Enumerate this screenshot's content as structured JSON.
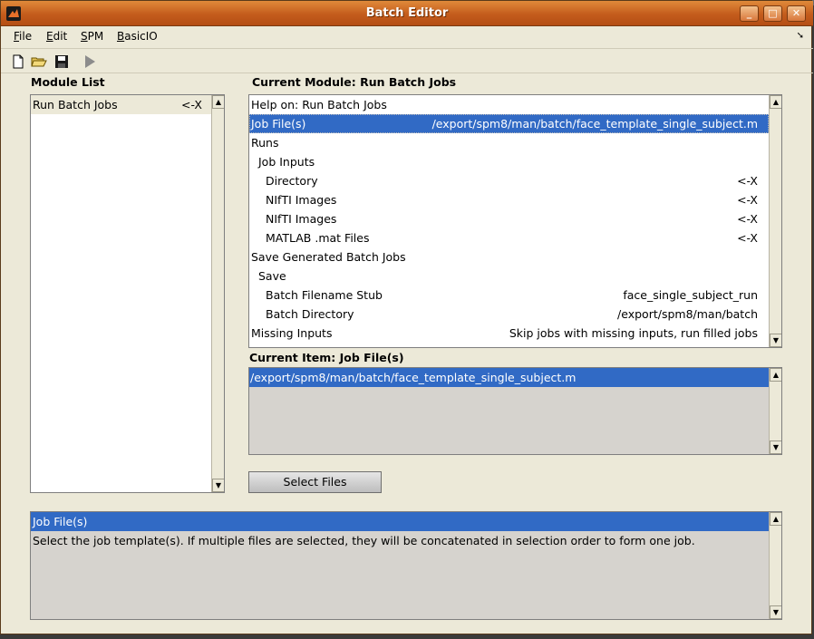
{
  "window": {
    "title": "Batch Editor"
  },
  "menu": [
    {
      "label": "File",
      "mnemonic": "F",
      "rest": "ile"
    },
    {
      "label": "Edit",
      "mnemonic": "E",
      "rest": "dit"
    },
    {
      "label": "SPM",
      "mnemonic": "S",
      "rest": "PM"
    },
    {
      "label": "BasicIO",
      "mnemonic": "B",
      "rest": "asicIO"
    }
  ],
  "toolbar": {
    "icons": [
      "new-file-icon",
      "open-folder-icon",
      "save-icon",
      "run-icon"
    ]
  },
  "module_list": {
    "heading": "Module List",
    "items": [
      {
        "label": "Run Batch Jobs",
        "value": "<-X"
      }
    ]
  },
  "current_module": {
    "heading": "Current Module: Run Batch Jobs",
    "rows": [
      {
        "label": "Help on: Run Batch Jobs",
        "value": "",
        "indent": 0
      },
      {
        "label": "Job File(s)",
        "value": "/export/spm8/man/batch/face_template_single_subject.m",
        "indent": 0,
        "selected": true
      },
      {
        "label": "Runs",
        "value": "",
        "indent": 0
      },
      {
        "label": "Job Inputs",
        "value": "",
        "indent": 1
      },
      {
        "label": "Directory",
        "value": "<-X",
        "indent": 2
      },
      {
        "label": "NIfTI Images",
        "value": "<-X",
        "indent": 2
      },
      {
        "label": "NIfTI Images",
        "value": "<-X",
        "indent": 2
      },
      {
        "label": "MATLAB .mat Files",
        "value": "<-X",
        "indent": 2
      },
      {
        "label": "Save Generated Batch Jobs",
        "value": "",
        "indent": 0
      },
      {
        "label": "Save",
        "value": "",
        "indent": 1
      },
      {
        "label": "Batch Filename Stub",
        "value": "face_single_subject_run",
        "indent": 2
      },
      {
        "label": "Batch Directory",
        "value": "/export/spm8/man/batch",
        "indent": 2
      },
      {
        "label": "Missing Inputs",
        "value": "Skip jobs with missing inputs, run filled jobs",
        "indent": 0
      }
    ]
  },
  "current_item": {
    "heading": "Current Item: Job File(s)",
    "values": [
      "/export/spm8/man/batch/face_template_single_subject.m"
    ]
  },
  "select_button": {
    "label": "Select Files"
  },
  "help": {
    "title": "Job File(s)",
    "text": "Select the job template(s). If multiple files are selected, they will be concatenated in selection order to form one job."
  }
}
